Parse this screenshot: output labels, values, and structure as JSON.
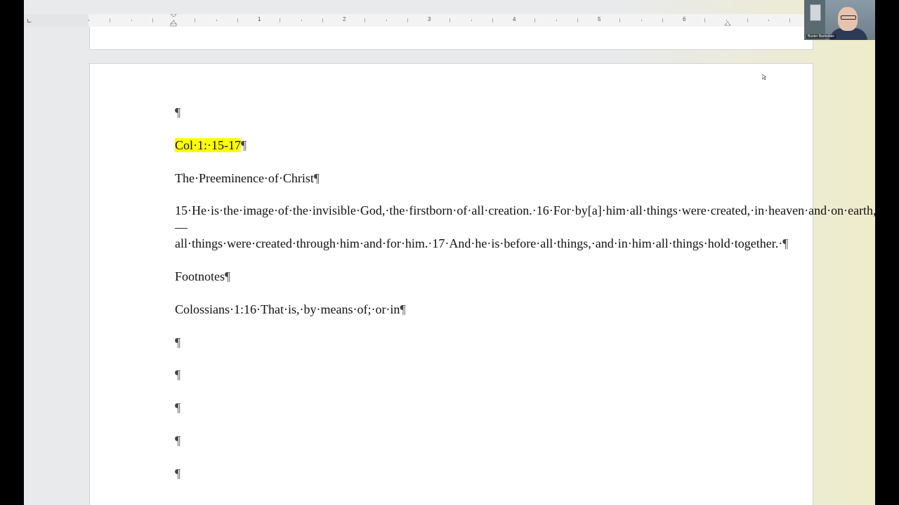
{
  "ruler": {
    "numbers": [
      "1",
      "2",
      "3",
      "4",
      "5",
      "6"
    ]
  },
  "document": {
    "paragraphs": [
      {
        "text": "",
        "pilcrow": "¶"
      },
      {
        "text": "Col·1:·15-17",
        "pilcrow": "¶",
        "highlight": true
      },
      {
        "text": "The·Preeminence·of·Christ",
        "pilcrow": "¶"
      },
      {
        "text": "15·He·is·the·image·of·the·invisible·God,·the·firstborn·of·all·creation.·16·For·by[a]·him·all·things·were·created,·in·heaven·and·on·earth,·visible·and·invisible,·whether·thrones·or·dominions·or·rulers·or·authorities—all·things·were·created·through·him·and·for·him.·17·And·he·is·before·all·things,·and·in·him·all·things·hold·together.·",
        "pilcrow": "¶"
      },
      {
        "text": "Footnotes",
        "pilcrow": "¶"
      },
      {
        "text": "Colossians·1:16·That·is,·by·means·of;·or·in",
        "pilcrow": "¶"
      },
      {
        "text": "",
        "pilcrow": "¶"
      },
      {
        "text": "",
        "pilcrow": "¶"
      },
      {
        "text": "",
        "pilcrow": "¶"
      },
      {
        "text": "",
        "pilcrow": "¶"
      },
      {
        "text": "",
        "pilcrow": "¶"
      }
    ]
  },
  "webcam": {
    "name": "Buster Barksdale"
  },
  "colors": {
    "highlight": "#ffff00",
    "page": "#ffffff",
    "workspace": "#e9eaec"
  }
}
